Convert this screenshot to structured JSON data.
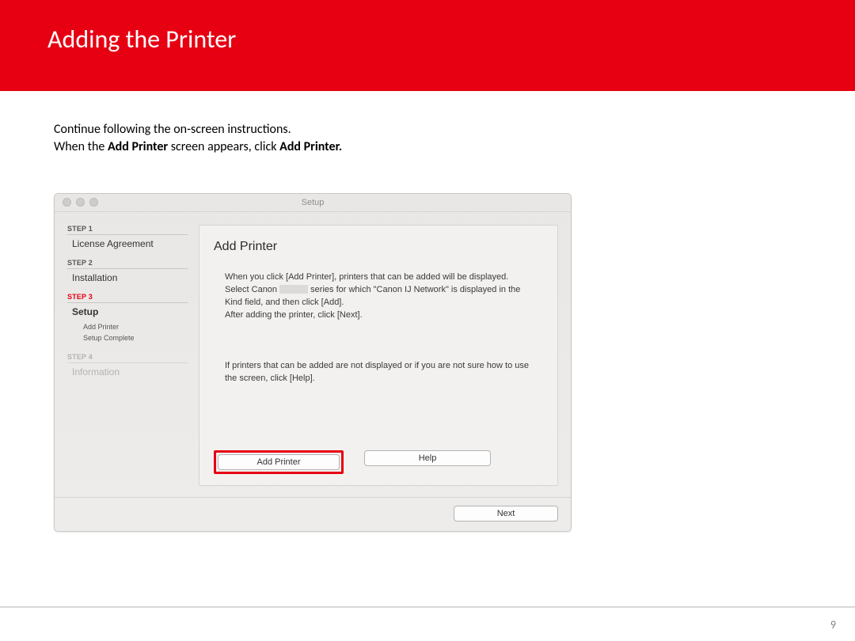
{
  "banner": {
    "title": "Adding  the Printer"
  },
  "instruction": {
    "line1": "Continue following the on-screen instructions.",
    "line2_pre": "When the ",
    "line2_b1": "Add Printer",
    "line2_mid": " screen appears, click ",
    "line2_b2": "Add Printer."
  },
  "window": {
    "title": "Setup",
    "sidebar": {
      "step1_label": "STEP 1",
      "step1_text": "License Agreement",
      "step2_label": "STEP 2",
      "step2_text": "Installation",
      "step3_label": "STEP 3",
      "step3_text": "Setup",
      "step3_sub1": "Add Printer",
      "step3_sub2": "Setup Complete",
      "step4_label": "STEP 4",
      "step4_text": "Information"
    },
    "pane": {
      "heading": "Add Printer",
      "p1a": "When you click [Add Printer], printers that can be added will be displayed. Select Canon ",
      "p1b": " series for which \"Canon IJ Network\" is displayed in the Kind field, and then click [Add].",
      "p1c": "After adding the printer, click [Next].",
      "p2": "If printers that can be added are not displayed or if you are not sure how to use the screen, click [Help].",
      "btn_add": "Add Printer",
      "btn_help": "Help"
    },
    "footer": {
      "btn_next": "Next"
    }
  },
  "page_number": "9"
}
